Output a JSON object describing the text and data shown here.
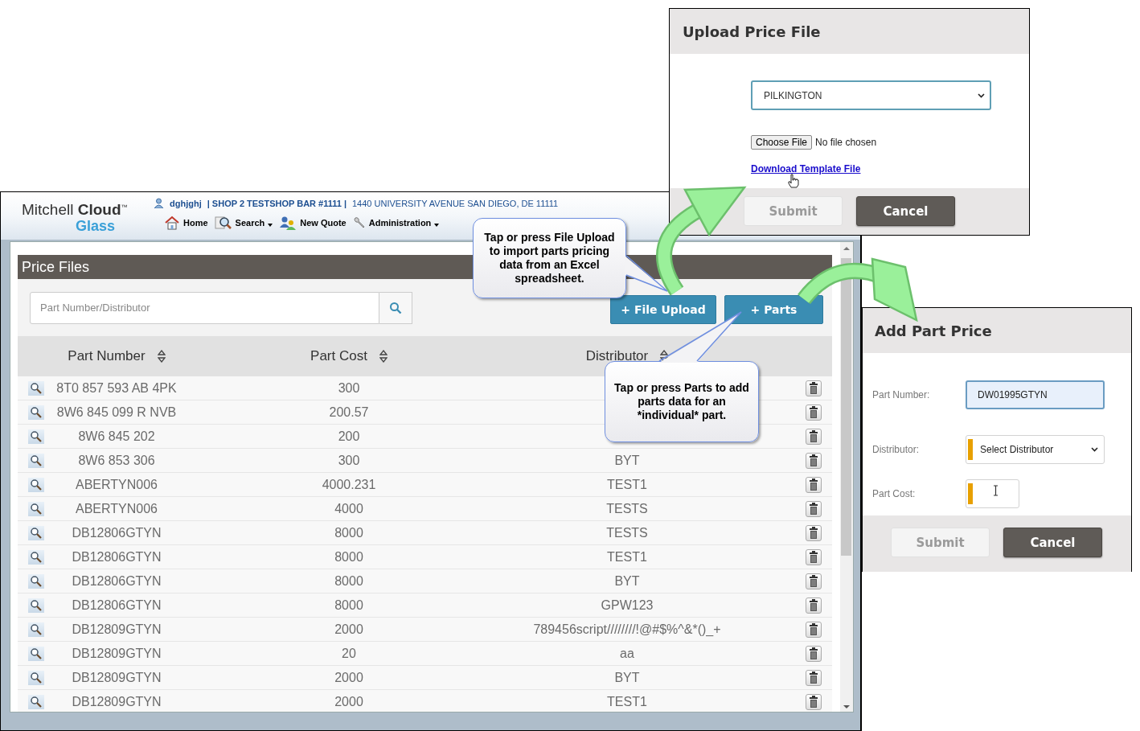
{
  "main_window": {
    "logo": {
      "name": "Mitchell **Cloud**$^{™}$",
      "product": "Glass"
    },
    "user": "dghjghj",
    "shop": "| SHOP 2 TESTSHOP BAR #1111 |",
    "address": "1440 UNIVERSITY AVENUE SAN DIEGO, DE 11111",
    "nav": [
      {
        "label": "Home",
        "kind": "home",
        "dropdown": false
      },
      {
        "label": "Search",
        "kind": "search",
        "dropdown": true
      },
      {
        "label": "New Quote",
        "kind": "people",
        "dropdown": false
      },
      {
        "label": "Administration",
        "kind": "wrench",
        "dropdown": true
      }
    ],
    "page_title": "Price Files",
    "search": {
      "placeholder": "Part Number/Distributor"
    },
    "buttons": [
      "+ File Upload",
      "+ Parts"
    ],
    "table": {
      "columns": [
        "Part Number",
        "Part Cost",
        "Distributor"
      ],
      "rows": [
        {
          "part_number": "8T0 857 593 AB 4PK",
          "part_cost": "300"
        },
        {
          "part_number": "8W6 845 099 R NVB",
          "part_cost": "200.57"
        },
        {
          "part_number": "8W6 845 202",
          "part_cost": "200"
        },
        {
          "part_number": "8W6 853 306",
          "part_cost": "300",
          "distributor": "BYT"
        },
        {
          "part_number": "ABERTYN006",
          "part_cost": "4000.231",
          "distributor": "TEST1"
        },
        {
          "part_number": "ABERTYN006",
          "part_cost": "4000",
          "distributor": "TESTS"
        },
        {
          "part_number": "DB12806GTYN",
          "part_cost": "8000",
          "distributor": "TESTS"
        },
        {
          "part_number": "DB12806GTYN",
          "part_cost": "8000",
          "distributor": "TEST1"
        },
        {
          "part_number": "DB12806GTYN",
          "part_cost": "8000",
          "distributor": "BYT"
        },
        {
          "part_number": "DB12806GTYN",
          "part_cost": "8000",
          "distributor": "GPW123"
        },
        {
          "part_number": "DB12809GTYN",
          "part_cost": "2000",
          "distributor": "789456script////////!@#$%^&*()_+"
        },
        {
          "part_number": "DB12809GTYN",
          "part_cost": "20",
          "distributor": "aa"
        },
        {
          "part_number": "DB12809GTYN",
          "part_cost": "2000",
          "distributor": "BYT"
        },
        {
          "part_number": "DB12809GTYN",
          "part_cost": "2000",
          "distributor": "TEST1"
        }
      ]
    }
  },
  "callouts": [
    "Tap or press File Upload to import parts pricing data from an Excel spreadsheet.",
    "Tap or press Parts to add parts data for an *individual* part."
  ],
  "upload_dialog": {
    "title": "Upload Price File",
    "distributor_select": {
      "value": "PILKINGTON",
      "focused": true
    },
    "file_button": "Choose File",
    "file_status": "No file chosen",
    "template_link": "Download Template File",
    "buttons": [
      {
        "label": "Submit",
        "disabled": true
      },
      {
        "label": "Cancel",
        "disabled": false
      }
    ]
  },
  "add_part_dialog": {
    "title": "Add Part Price",
    "fields": [
      {
        "label": "Part Number:",
        "kind": "text",
        "value": "DW01995GTYN",
        "required": false,
        "focused": true
      },
      {
        "label": "Distributor:",
        "kind": "select",
        "value": "Select Distributor",
        "required": true,
        "focused": false
      },
      {
        "label": "Part Cost:",
        "kind": "text",
        "required": true,
        "focused": false
      }
    ],
    "buttons": [
      {
        "label": "Submit",
        "disabled": true
      },
      {
        "label": "Cancel",
        "disabled": false
      }
    ]
  }
}
